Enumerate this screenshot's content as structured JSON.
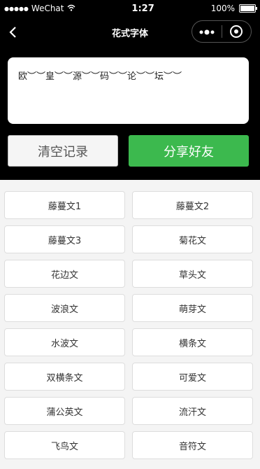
{
  "status_bar": {
    "signal": "●●●●●",
    "carrier": "WeChat",
    "time": "1:27",
    "battery": "100%"
  },
  "navbar": {
    "title": "花式字体",
    "back_icon": "chevron-left-icon",
    "more_icon": "more-dots-icon",
    "close_icon": "record-circle-icon"
  },
  "editor": {
    "text": "欧︶︶皇︶︶源︶︶码︶︶论︶︶坛︶︶"
  },
  "actions": {
    "clear_label": "清空记录",
    "share_label": "分享好友",
    "share_color": "#3cb94e"
  },
  "styles": [
    "藤蔓文1",
    "藤蔓文2",
    "藤蔓文3",
    "菊花文",
    "花边文",
    "草头文",
    "波浪文",
    "萌芽文",
    "水波文",
    "横条文",
    "双横条文",
    "可爱文",
    "蒲公英文",
    "流汗文",
    "飞鸟文",
    "音符文"
  ]
}
